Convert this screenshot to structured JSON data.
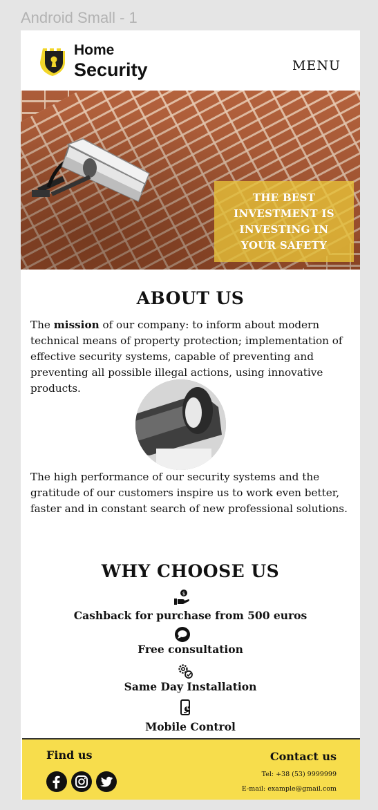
{
  "frame": {
    "label": "Android Small - 1"
  },
  "header": {
    "brand_line1": "Home",
    "brand_line2": "Security",
    "menu_label": "MENU"
  },
  "hero": {
    "tagline": "THE BEST INVESTMENT IS INVESTING IN YOUR  SAFETY"
  },
  "about": {
    "title": "ABOUT US",
    "p1_lead": "The ",
    "p1_bold": "mission",
    "p1_rest": " of our company: to inform about modern technical means of property protection; implementation of effective security systems, capable of preventing and preventing all possible illegal actions, using innovative products.",
    "p2": "The high performance of our security systems and the gratitude of our customers inspire us to work even better, faster and in constant search of new professional solutions."
  },
  "why": {
    "title": "WHY CHOOSE US",
    "features": [
      {
        "icon": "cashback-hand-icon",
        "label": "Cashback for purchase from 500 euros"
      },
      {
        "icon": "chat-bubble-icon",
        "label": "Free consultation"
      },
      {
        "icon": "gears-check-icon",
        "label": "Same Day Installation"
      },
      {
        "icon": "mobile-control-icon",
        "label": "Mobile Control"
      }
    ]
  },
  "footer": {
    "find_us": "Find us",
    "contact_us": "Contact us",
    "tel": "Tel:  +38 (53) 9999999",
    "email": "E-mail:  example@gmail.com",
    "social": [
      "facebook-icon",
      "instagram-icon",
      "twitter-icon"
    ]
  },
  "colors": {
    "accent_yellow": "#f7dd4c",
    "hero_box": "#e9c438",
    "text": "#111111"
  }
}
